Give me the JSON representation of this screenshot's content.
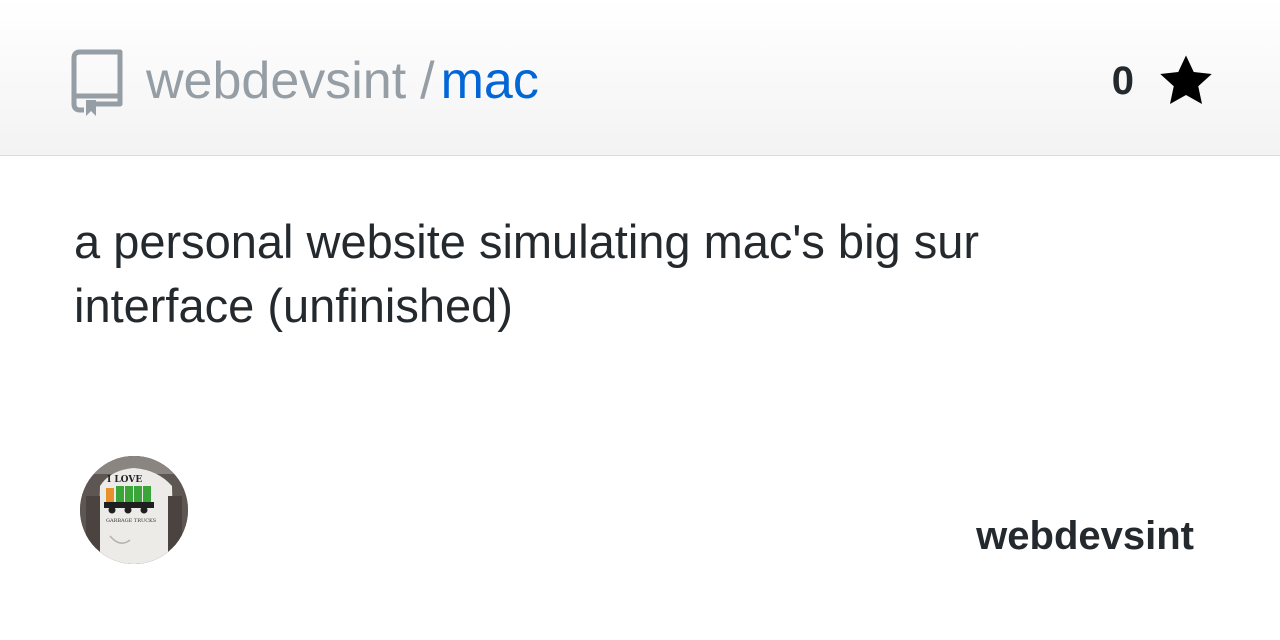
{
  "repo": {
    "owner": "webdevsint",
    "separator": "/",
    "name": "mac",
    "star_count": "0",
    "description": "a personal website simulating mac's big sur interface (unfinished)"
  },
  "footer": {
    "owner_login": "webdevsint"
  },
  "icons": {
    "repo": "repo-icon",
    "star": "star-icon"
  },
  "avatar_text": {
    "top": "I LOVE",
    "bottom": "GARBAGE TRUCKS"
  },
  "colors": {
    "link": "#0366d6",
    "muted": "#959da5",
    "text": "#24292e"
  }
}
